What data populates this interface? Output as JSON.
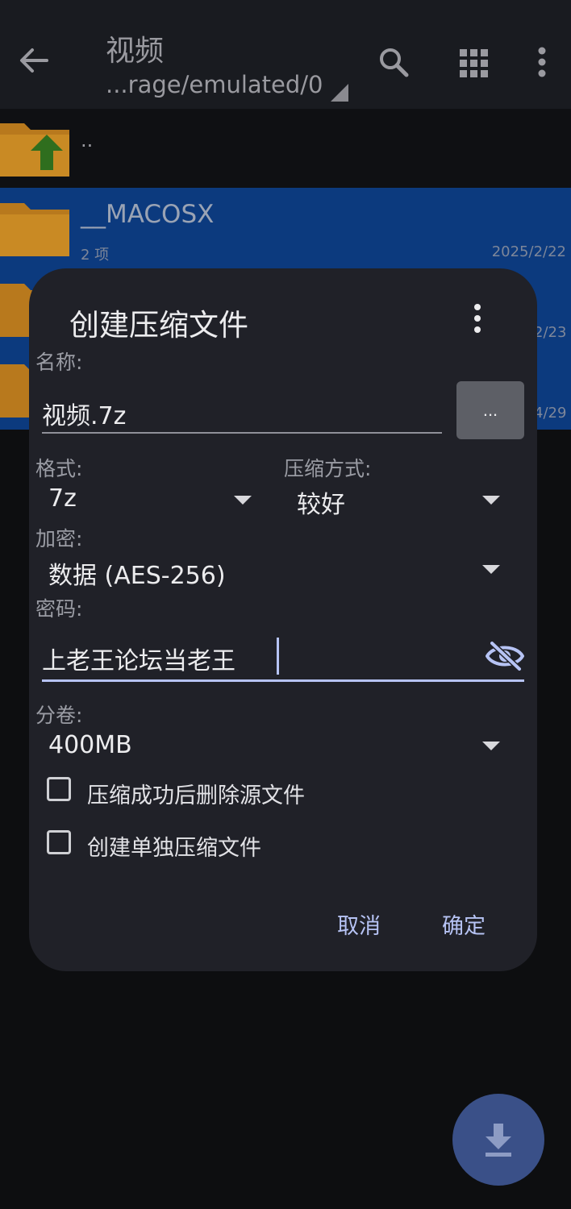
{
  "appbar": {
    "title": "视频",
    "path": "...rage/emulated/0",
    "icons": [
      "back-arrow-icon",
      "search-icon",
      "grid-view-icon",
      "more-vertical-icon"
    ]
  },
  "file_list": {
    "parent_label": "..",
    "items": [
      {
        "name": "__MACOSX",
        "count": "2 项",
        "date": "2025/2/22"
      },
      {
        "date_partial": "2/23"
      },
      {
        "date_partial": "4/29"
      }
    ]
  },
  "dialog": {
    "title": "创建压缩文件",
    "name_label": "名称:",
    "name_value": "视频.7z",
    "browse_label": "...",
    "format_label": "格式:",
    "format_value": "7z",
    "method_label": "压缩方式:",
    "method_value": "较好",
    "encrypt_label": "加密:",
    "encrypt_value": "数据 (AES-256)",
    "password_label": "密码:",
    "password_value": "上老王论坛当老王",
    "volume_label": "分卷:",
    "volume_value": "400MB",
    "delete_source_label": "压缩成功后删除源文件",
    "separate_label": "创建单独压缩文件",
    "delete_source_checked": false,
    "separate_checked": false,
    "cancel_label": "取消",
    "ok_label": "确定"
  },
  "colors": {
    "accent": "#b6c3f4",
    "selection": "#0c3a7e",
    "dialog_bg": "#202128",
    "fab": "#3a5088"
  }
}
